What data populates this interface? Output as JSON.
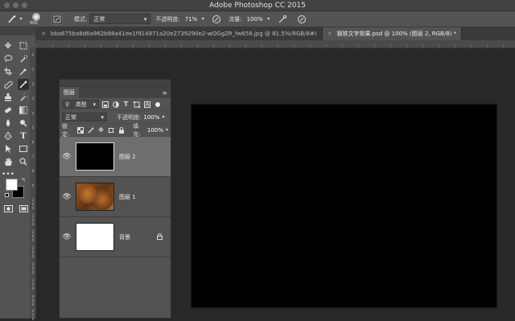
{
  "app": {
    "title": "Adobe Photoshop CC 2015"
  },
  "options_bar": {
    "brush_size": "600",
    "mode_label": "模式:",
    "mode_value": "正常",
    "opacity_label": "不透明度:",
    "opacity_value": "71%",
    "flow_label": "流量:",
    "flow_value": "100%"
  },
  "tabs": [
    {
      "label": "bba675ba8d6a962b88a41ee1f914971a20e2739290e2-wOGgZR_fw658.jpg @ 81.5%(RGB/8#)",
      "active": false
    },
    {
      "label": "钢铁文字效果.psd @ 100% (图层 2, RGB/8) *",
      "active": true
    }
  ],
  "rulers": {
    "left": [
      "0",
      "1",
      "2",
      "3",
      "4",
      "5",
      "6",
      "7",
      "8",
      "9",
      "1\n0\n0",
      "1\n5\n0",
      "2\n0\n0",
      "2\n5\n0",
      "3\n0\n0",
      "3\n5\n0",
      "4\n0\n0",
      "4\n5\n0"
    ]
  },
  "layers_panel": {
    "tab_label": "图层",
    "filter_label": "类型",
    "blend_mode": "正常",
    "opacity_label": "不透明度:",
    "opacity_value": "100%",
    "lock_label": "锁定:",
    "fill_label": "填充:",
    "fill_value": "100%",
    "layers": [
      {
        "name": "图层 2",
        "selected": true,
        "thumb": "black"
      },
      {
        "name": "图层 1",
        "selected": false,
        "thumb": "rust"
      },
      {
        "name": "背景",
        "selected": false,
        "thumb": "white",
        "locked": true
      }
    ]
  },
  "colors": {
    "foreground": "#ffffff",
    "background": "#000000",
    "document": "#000000",
    "ui_panel": "#535353"
  }
}
